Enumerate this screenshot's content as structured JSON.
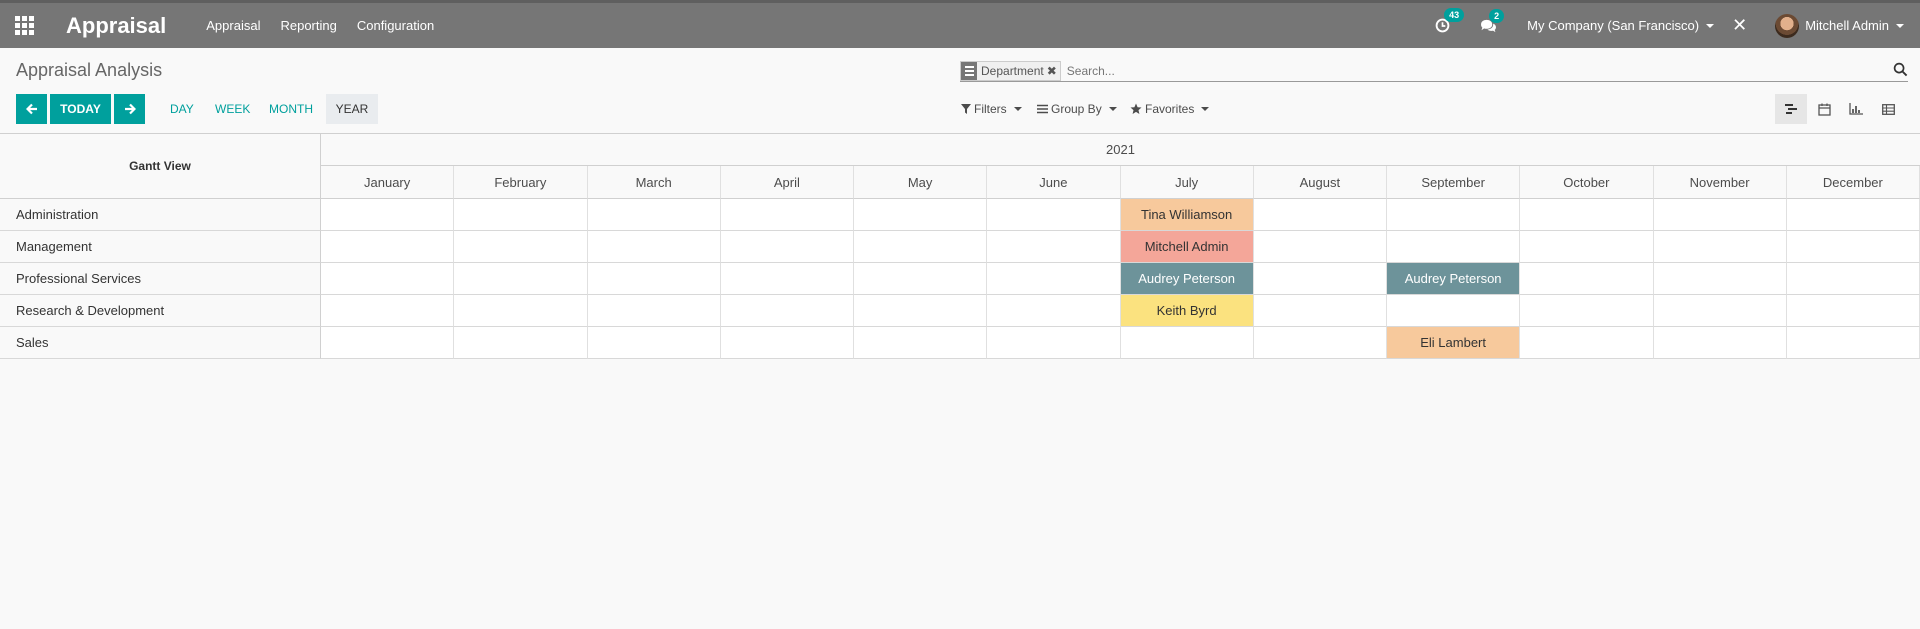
{
  "navbar": {
    "app_title": "Appraisal",
    "menus": [
      "Appraisal",
      "Reporting",
      "Configuration"
    ],
    "activity_count": "43",
    "message_count": "2",
    "company": "My Company (San Francisco)",
    "user": "Mitchell Admin",
    "bg_color": "#767676"
  },
  "control": {
    "breadcrumb": "Appraisal Analysis",
    "facet_label": "Department",
    "search_placeholder": "Search...",
    "today_label": "TODAY",
    "scales": [
      "DAY",
      "WEEK",
      "MONTH",
      "YEAR"
    ],
    "active_scale": "YEAR",
    "filters_label": "Filters",
    "groupby_label": "Group By",
    "favorites_label": "Favorites",
    "views": [
      "gantt-icon",
      "calendar-icon",
      "graph-icon",
      "pivot-icon"
    ],
    "accent_color": "#00a09d"
  },
  "gantt": {
    "title": "Gantt View",
    "year": "2021",
    "months": [
      "January",
      "February",
      "March",
      "April",
      "May",
      "June",
      "July",
      "August",
      "September",
      "October",
      "November",
      "December"
    ],
    "rows": [
      {
        "label": "Administration",
        "pills": [
          {
            "month": 6,
            "name": "Tina Williamson",
            "color": "#f7c99c"
          }
        ]
      },
      {
        "label": "Management",
        "pills": [
          {
            "month": 6,
            "name": "Mitchell Admin",
            "color": "#f4a699"
          }
        ]
      },
      {
        "label": "Professional Services",
        "pills": [
          {
            "month": 6,
            "name": "Audrey Peterson",
            "color": "#6d939a",
            "light": true
          },
          {
            "month": 8,
            "name": "Audrey Peterson",
            "color": "#6d939a",
            "light": true
          }
        ]
      },
      {
        "label": "Research & Development",
        "pills": [
          {
            "month": 6,
            "name": "Keith Byrd",
            "color": "#fbe27f"
          }
        ]
      },
      {
        "label": "Sales",
        "pills": [
          {
            "month": 8,
            "name": "Eli Lambert",
            "color": "#f7c99c"
          }
        ]
      }
    ]
  }
}
